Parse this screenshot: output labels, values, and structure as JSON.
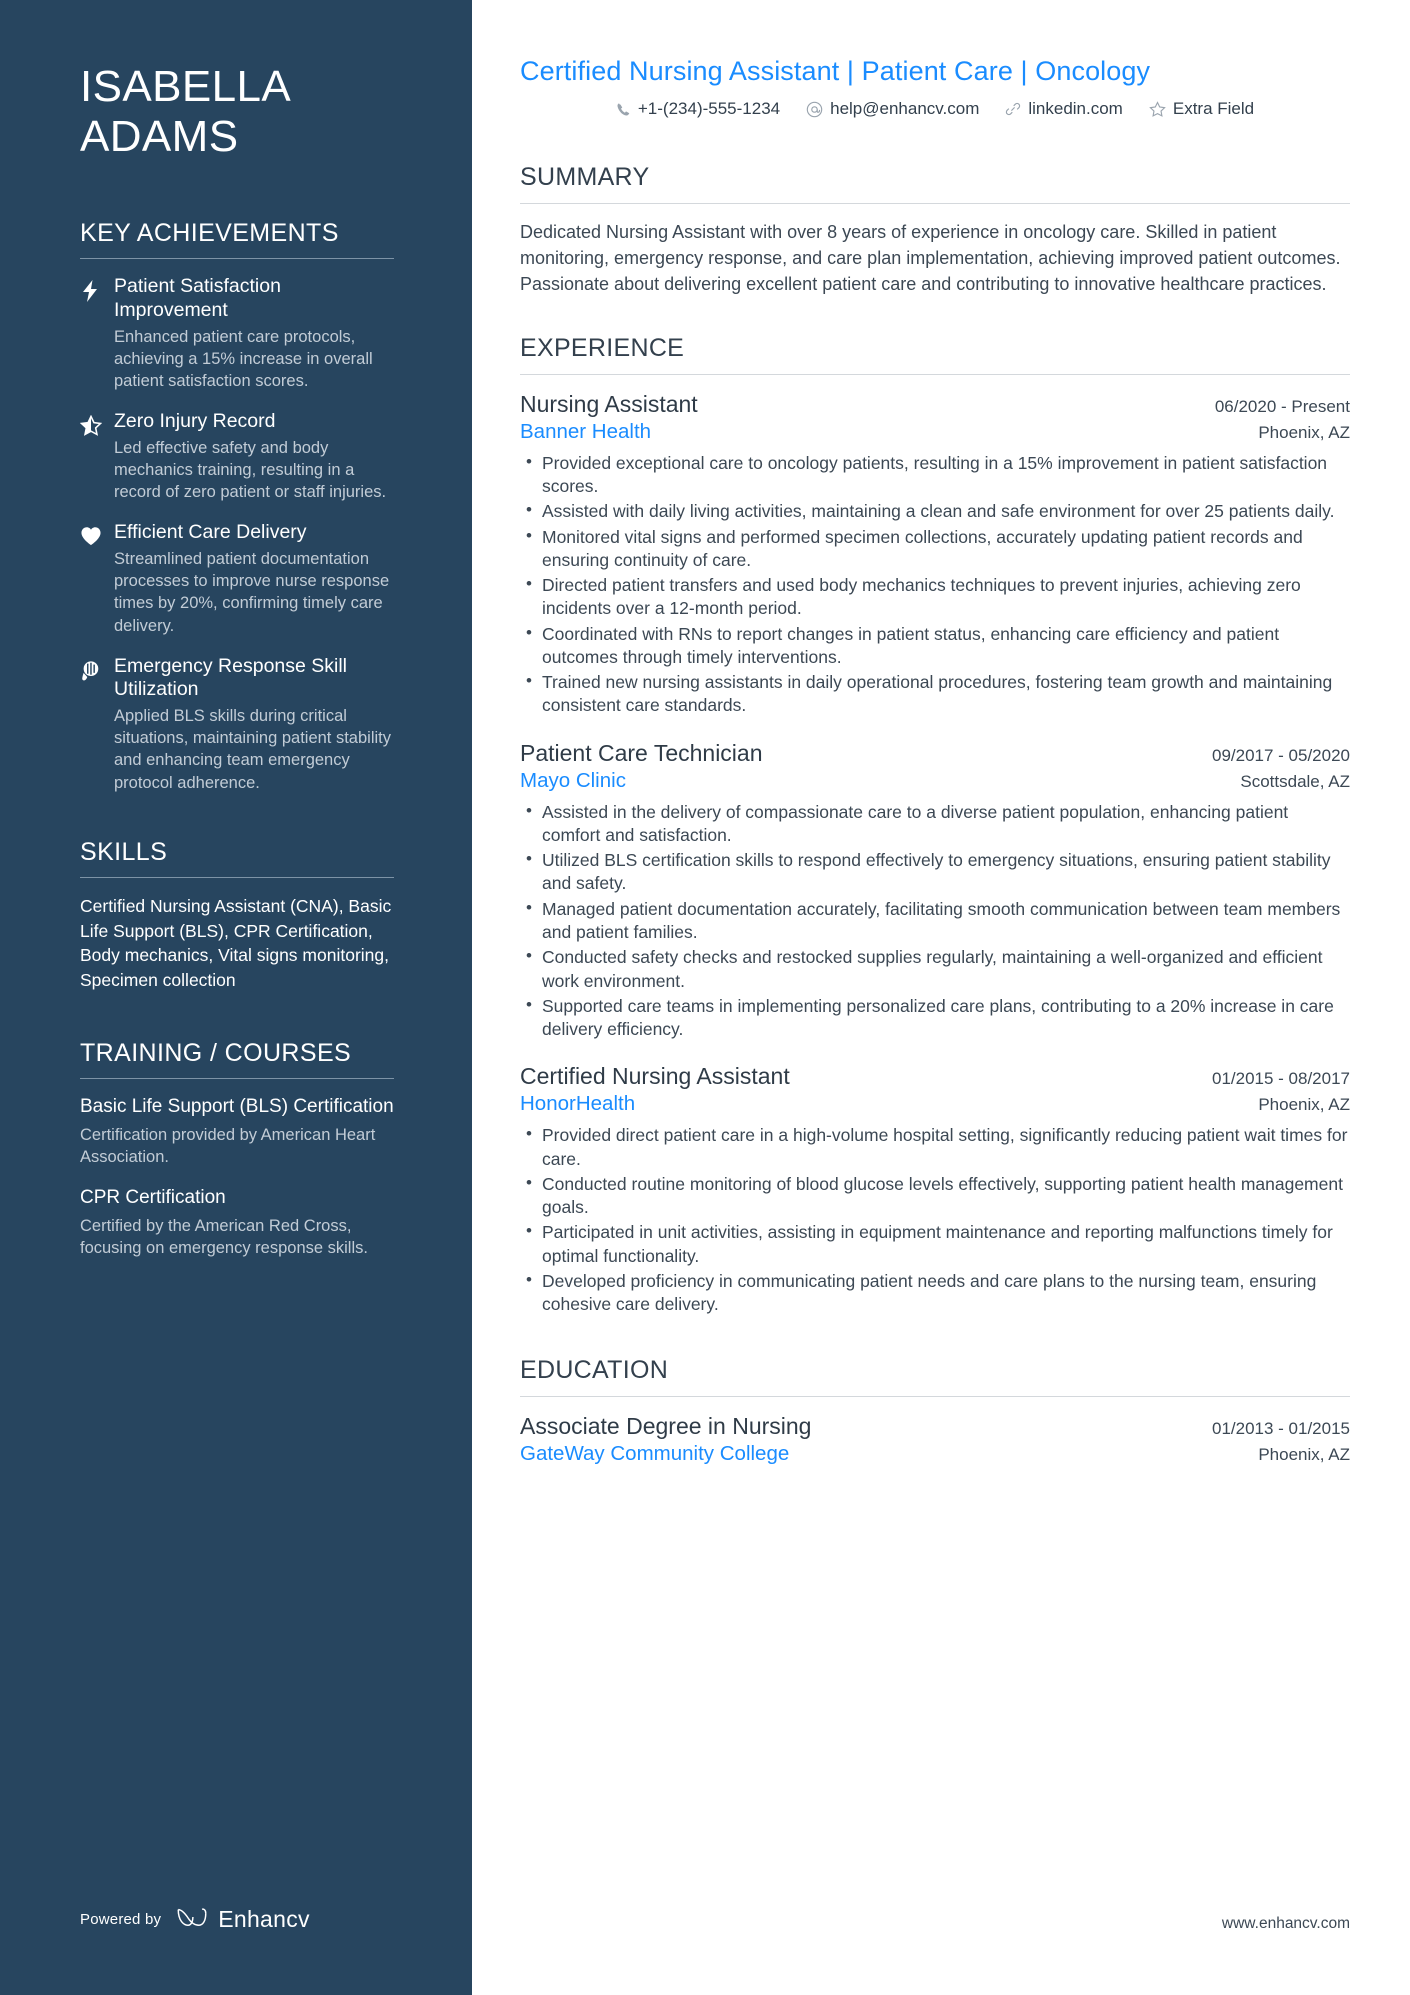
{
  "sidebar": {
    "name_first": "ISABELLA",
    "name_last": "ADAMS",
    "achievements_heading": "KEY ACHIEVEMENTS",
    "achievements": [
      {
        "icon": "lightning-bolt-icon",
        "title": "Patient Satisfaction Improvement",
        "description": "Enhanced patient care protocols, achieving a 15% increase in overall patient satisfaction scores."
      },
      {
        "icon": "star-half-icon",
        "title": "Zero Injury Record",
        "description": "Led effective safety and body mechanics training, resulting in a record of zero patient or staff injuries."
      },
      {
        "icon": "heart-icon",
        "title": "Efficient Care Delivery",
        "description": "Streamlined patient documentation processes to improve nurse response times by 20%, confirming timely care delivery."
      },
      {
        "icon": "lightbulb-head-icon",
        "title": "Emergency Response Skill Utilization",
        "description": "Applied BLS skills during critical situations, maintaining patient stability and enhancing team emergency protocol adherence."
      }
    ],
    "skills_heading": "SKILLS",
    "skills_text": "Certified Nursing Assistant (CNA), Basic Life Support (BLS), CPR Certification, Body mechanics, Vital signs monitoring, Specimen collection",
    "training_heading": "TRAINING / COURSES",
    "training": [
      {
        "title": "Basic Life Support (BLS) Certification",
        "description": "Certification provided by American Heart Association."
      },
      {
        "title": "CPR Certification",
        "description": "Certified by the American Red Cross, focusing on emergency response skills."
      }
    ],
    "footer": {
      "powered_by": "Powered by",
      "brand": "Enhancv"
    }
  },
  "main": {
    "headline_parts": [
      "Certified Nursing Assistant",
      "Patient Care",
      "Oncology"
    ],
    "headline": "Certified Nursing Assistant | Patient Care | Oncology",
    "contacts": [
      {
        "icon": "phone-icon",
        "text": "+1-(234)-555-1234"
      },
      {
        "icon": "at-email-icon",
        "text": "help@enhancv.com"
      },
      {
        "icon": "link-icon",
        "text": "linkedin.com"
      },
      {
        "icon": "star-outline-icon",
        "text": "Extra Field"
      }
    ],
    "summary_heading": "SUMMARY",
    "summary_text": "Dedicated Nursing Assistant with over 8 years of experience in oncology care. Skilled in patient monitoring, emergency response, and care plan implementation, achieving improved patient outcomes. Passionate about delivering excellent patient care and contributing to innovative healthcare practices.",
    "experience_heading": "EXPERIENCE",
    "experience": [
      {
        "title": "Nursing Assistant",
        "dates": "06/2020 - Present",
        "company": "Banner Health",
        "location": "Phoenix, AZ",
        "bullets": [
          "Provided exceptional care to oncology patients, resulting in a 15% improvement in patient satisfaction scores.",
          "Assisted with daily living activities, maintaining a clean and safe environment for over 25 patients daily.",
          "Monitored vital signs and performed specimen collections, accurately updating patient records and ensuring continuity of care.",
          "Directed patient transfers and used body mechanics techniques to prevent injuries, achieving zero incidents over a 12-month period.",
          "Coordinated with RNs to report changes in patient status, enhancing care efficiency and patient outcomes through timely interventions.",
          "Trained new nursing assistants in daily operational procedures, fostering team growth and maintaining consistent care standards."
        ]
      },
      {
        "title": "Patient Care Technician",
        "dates": "09/2017 - 05/2020",
        "company": "Mayo Clinic",
        "location": "Scottsdale, AZ",
        "bullets": [
          "Assisted in the delivery of compassionate care to a diverse patient population, enhancing patient comfort and satisfaction.",
          "Utilized BLS certification skills to respond effectively to emergency situations, ensuring patient stability and safety.",
          "Managed patient documentation accurately, facilitating smooth communication between team members and patient families.",
          "Conducted safety checks and restocked supplies regularly, maintaining a well-organized and efficient work environment.",
          "Supported care teams in implementing personalized care plans, contributing to a 20% increase in care delivery efficiency."
        ]
      },
      {
        "title": "Certified Nursing Assistant",
        "dates": "01/2015 - 08/2017",
        "company": "HonorHealth",
        "location": "Phoenix, AZ",
        "bullets": [
          "Provided direct patient care in a high-volume hospital setting, significantly reducing patient wait times for care.",
          "Conducted routine monitoring of blood glucose levels effectively, supporting patient health management goals.",
          "Participated in unit activities, assisting in equipment maintenance and reporting malfunctions timely for optimal functionality.",
          "Developed proficiency in communicating patient needs and care plans to the nursing team, ensuring cohesive care delivery."
        ]
      }
    ],
    "education_heading": "EDUCATION",
    "education": [
      {
        "degree": "Associate Degree in Nursing",
        "dates": "01/2013 - 01/2015",
        "school": "GateWay Community College",
        "location": "Phoenix, AZ"
      }
    ],
    "site_url": "www.enhancv.com"
  },
  "colors": {
    "sidebar_bg": "#27455f",
    "accent_blue": "#1a8cff",
    "body_text": "#3c4854",
    "muted_sidebar_text": "#c2ccd6"
  }
}
